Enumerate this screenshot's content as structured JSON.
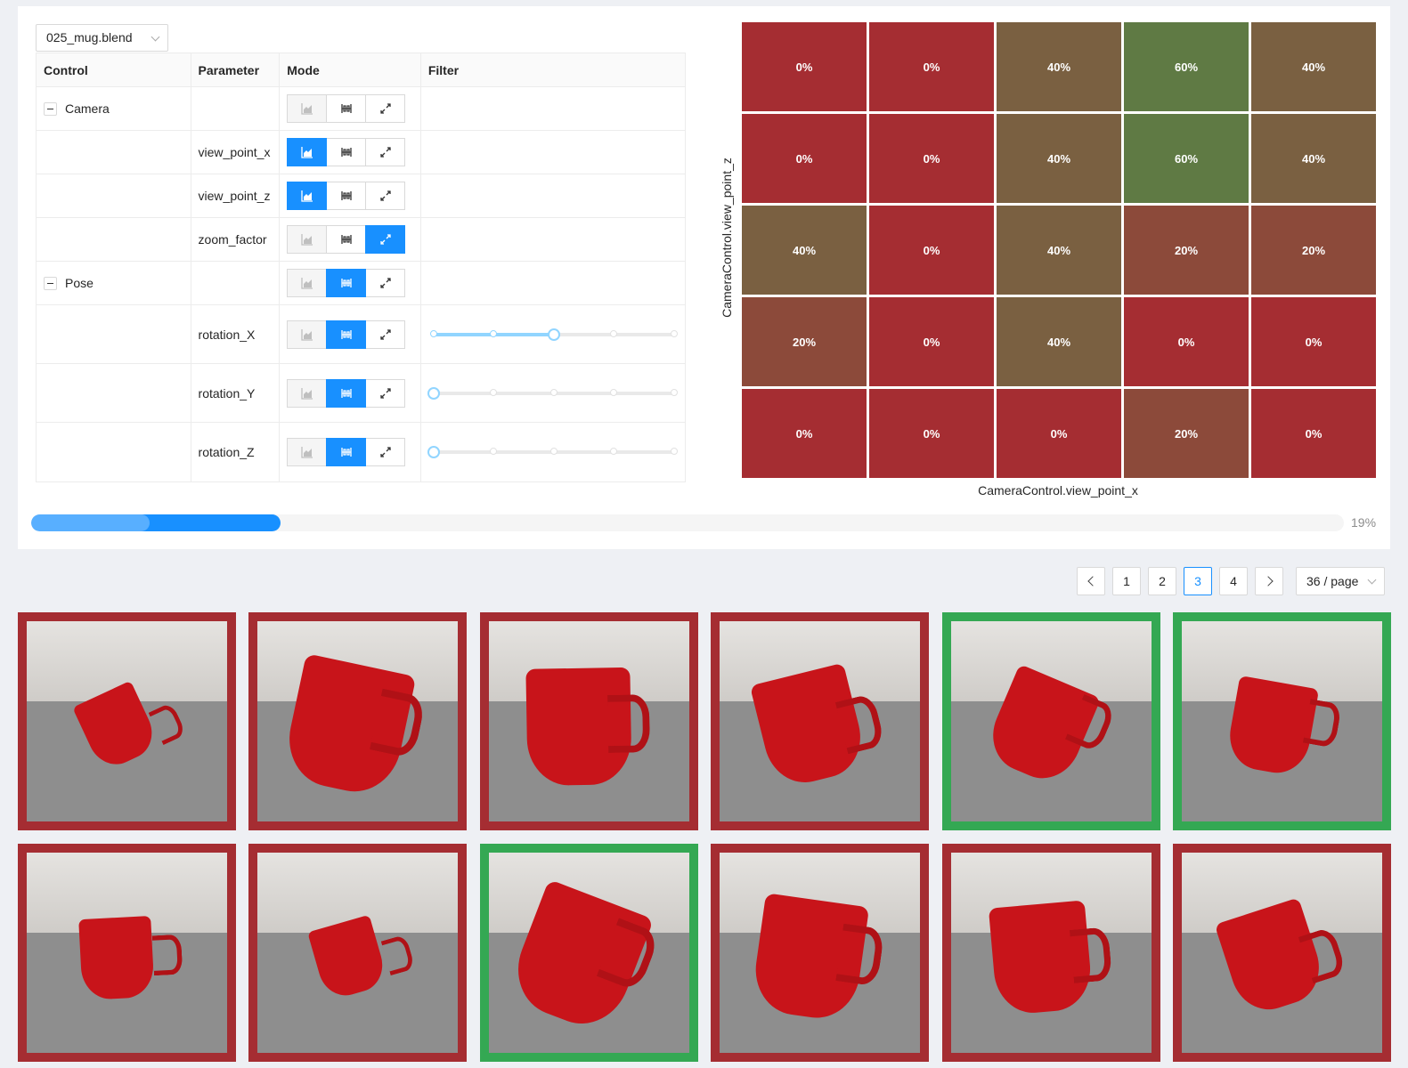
{
  "file_select": {
    "value": "025_mug.blend"
  },
  "table": {
    "headers": [
      "Control",
      "Parameter",
      "Mode",
      "Filter"
    ]
  },
  "rows": [
    {
      "control": "Camera",
      "parameter": "",
      "mode": "none",
      "type": "group"
    },
    {
      "control": "",
      "parameter": "view_point_x",
      "mode": "histogram",
      "type": "param"
    },
    {
      "control": "",
      "parameter": "view_point_z",
      "mode": "histogram",
      "type": "param"
    },
    {
      "control": "",
      "parameter": "zoom_factor",
      "mode": "compare",
      "type": "param"
    },
    {
      "control": "Pose",
      "parameter": "",
      "mode": "filter",
      "type": "group"
    },
    {
      "control": "",
      "parameter": "rotation_X",
      "mode": "filter",
      "type": "slider",
      "slider_steps": 5,
      "slider_value": 2
    },
    {
      "control": "",
      "parameter": "rotation_Y",
      "mode": "filter",
      "type": "slider",
      "slider_steps": 5,
      "slider_value": 0
    },
    {
      "control": "",
      "parameter": "rotation_Z",
      "mode": "filter",
      "type": "slider",
      "slider_steps": 5,
      "slider_value": 0
    }
  ],
  "chart_data": {
    "type": "heatmap",
    "xlabel": "CameraControl.view_point_x",
    "ylabel": "CameraControl.view_point_z",
    "values": [
      [
        0,
        0,
        40,
        60,
        40
      ],
      [
        0,
        0,
        40,
        60,
        40
      ],
      [
        40,
        0,
        40,
        20,
        20
      ],
      [
        20,
        0,
        40,
        0,
        0
      ],
      [
        0,
        0,
        0,
        20,
        0
      ]
    ],
    "unit": "%",
    "colors": {
      "0": "#a52d32",
      "20": "#8c4a3a",
      "40": "#7a6041",
      "60": "#5f7a44"
    }
  },
  "progress": {
    "percent": 19,
    "label": "19%",
    "buffer_percent": 9
  },
  "pagination": {
    "pages": [
      "1",
      "2",
      "3",
      "4"
    ],
    "current": "3",
    "page_size": "36 / page"
  },
  "gallery": {
    "items": [
      {
        "status": "fail"
      },
      {
        "status": "fail"
      },
      {
        "status": "fail"
      },
      {
        "status": "fail"
      },
      {
        "status": "pass"
      },
      {
        "status": "pass"
      },
      {
        "status": "fail"
      },
      {
        "status": "fail"
      },
      {
        "status": "pass"
      },
      {
        "status": "fail"
      },
      {
        "status": "fail"
      },
      {
        "status": "fail"
      }
    ],
    "colors": {
      "fail": "#a52d32",
      "pass": "#34a853"
    }
  }
}
